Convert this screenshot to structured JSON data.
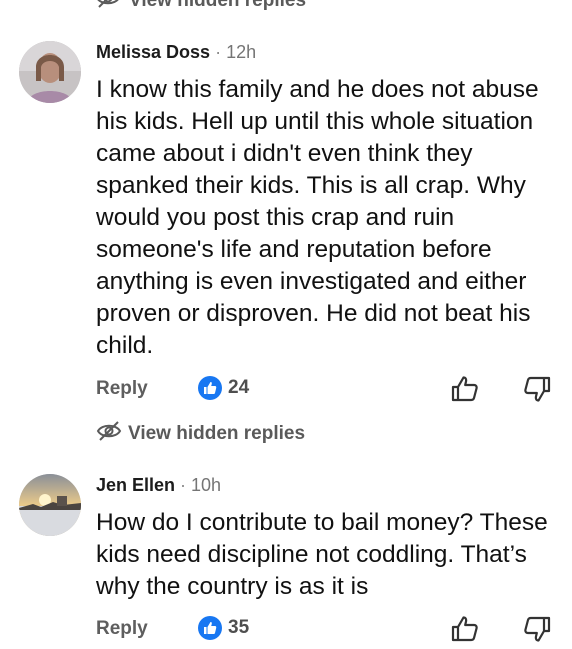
{
  "top_partial": {
    "label": "View hidden replies"
  },
  "comments": [
    {
      "author": "Melissa Doss",
      "separator": "·",
      "time": "12h",
      "text": "I know this family and he does not abuse his kids. Hell up until this whole situation came about i didn't even think they spanked their kids. This is all crap. Why would you post this crap and ruin someone's life and reputation before anything is even investigated and either proven or disproven. He did not beat his child.",
      "reply_label": "Reply",
      "like_count": "24",
      "hidden_replies_label": "View hidden replies",
      "icons": {
        "reaction": "like-icon",
        "upvote": "thumbs-up-outline-icon",
        "downvote": "thumbs-down-outline-icon",
        "hidden": "eye-slash-icon"
      }
    },
    {
      "author": "Jen Ellen",
      "separator": "·",
      "time": "10h",
      "text": "How do I contribute to bail money? These kids need discipline not coddling. That’s why the country is as it is",
      "reply_label": "Reply",
      "like_count": "35",
      "icons": {
        "reaction": "like-icon",
        "upvote": "thumbs-up-outline-icon",
        "downvote": "thumbs-down-outline-icon"
      }
    }
  ],
  "colors": {
    "like_blue": "#1877f2",
    "muted_text": "#5e5e5e",
    "body_text": "#111111"
  }
}
